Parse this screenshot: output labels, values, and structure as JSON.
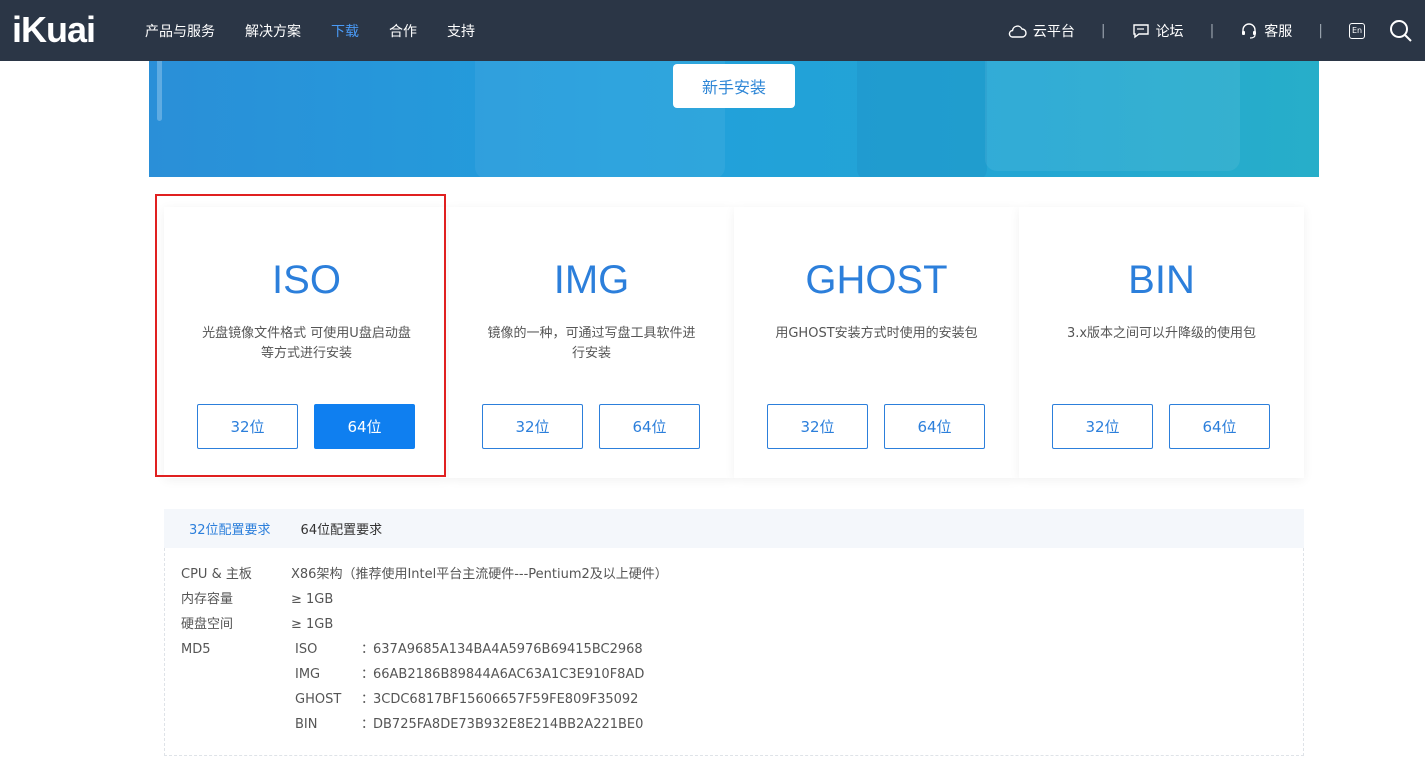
{
  "header": {
    "logo": "iKuai",
    "nav": [
      "产品与服务",
      "解决方案",
      "下载",
      "合作",
      "支持"
    ],
    "active_index": 2,
    "right": {
      "cloud": "云平台",
      "forum": "论坛",
      "service": "客服",
      "en": "En",
      "separator": "|"
    }
  },
  "banner": {
    "button": "新手安装"
  },
  "cards": [
    {
      "title": "ISO",
      "desc": "光盘镜像文件格式 可使用U盘启动盘等方式进行安装",
      "btn32": "32位",
      "btn64": "64位"
    },
    {
      "title": "IMG",
      "desc": "镜像的一种，可通过写盘工具软件进行安装",
      "btn32": "32位",
      "btn64": "64位"
    },
    {
      "title": "GHOST",
      "desc": "用GHOST安装方式时使用的安装包",
      "btn32": "32位",
      "btn64": "64位"
    },
    {
      "title": "BIN",
      "desc": "3.x版本之间可以升降级的使用包",
      "btn32": "32位",
      "btn64": "64位"
    }
  ],
  "tabs": [
    "32位配置要求",
    "64位配置要求"
  ],
  "specs": {
    "cpu_label": "CPU & 主板",
    "cpu_value": "X86架构（推荐使用Intel平台主流硬件---Pentium2及以上硬件）",
    "mem_label": "内存容量",
    "mem_value": "≥ 1GB",
    "disk_label": "硬盘空间",
    "disk_value": "≥ 1GB",
    "md5_label": "MD5",
    "colon": "：",
    "md5": [
      {
        "name": "ISO",
        "value": "637A9685A134BA4A5976B69415BC2968"
      },
      {
        "name": "IMG",
        "value": "66AB2186B89844A6AC63A1C3E910F8AD"
      },
      {
        "name": "GHOST",
        "value": "3CDC6817BF15606657F59FE809F35092"
      },
      {
        "name": "BIN",
        "value": "DB725FA8DE73B932E8E214BB2A221BE0"
      }
    ]
  },
  "colors": {
    "nav_bg": "#2b3646",
    "accent": "#2c7fdb",
    "primary_btn": "#0f7ff0",
    "highlight": "#e02020"
  }
}
